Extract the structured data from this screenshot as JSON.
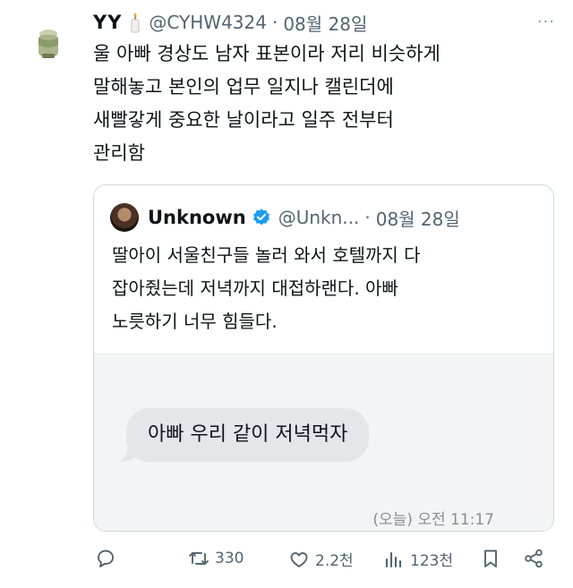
{
  "tweet": {
    "display_name": "YY",
    "handle": "@CYHW4324",
    "separator": "·",
    "date": "08월 28일",
    "more": "···",
    "text": "울 아빠 경상도 남자 표본이라 저리 비슷하게\n말해놓고 본인의 업무 일지나 캘린더에\n새빨갛게 중요한 날이라고 일주 전부터\n관리함"
  },
  "quote": {
    "display_name": "Unknown",
    "handle": "@Unkn...",
    "separator": "·",
    "date": "08월 28일",
    "text": "딸아이 서울친구들 놀러 와서 호텔까지 다\n잡아줬는데 저녁까지 대접하랜다. 아빠\n노릇하기 너무 힘들다.",
    "image": {
      "message": "아빠 우리 같이 저녁먹자",
      "time": "(오늘) 오전 11:17"
    }
  },
  "actions": {
    "reply_count": "",
    "retweets": "330",
    "likes": "2.2천",
    "views": "123천"
  },
  "icons": [
    "candle-icon",
    "verified-icon",
    "reply-icon",
    "retweet-icon",
    "like-icon",
    "views-icon",
    "bookmark-icon",
    "share-icon"
  ],
  "colors": {
    "verified": "#1d9bf0",
    "secondary_text": "#536471",
    "bubble": "#e5e6ea"
  }
}
